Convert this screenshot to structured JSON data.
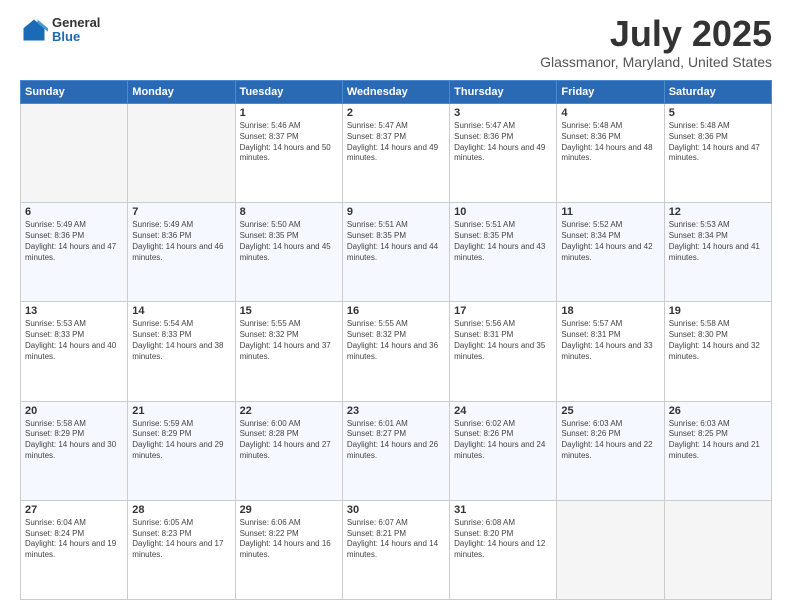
{
  "header": {
    "logo": {
      "line1": "General",
      "line2": "Blue"
    },
    "title": "July 2025",
    "subtitle": "Glassmanor, Maryland, United States"
  },
  "calendar": {
    "days_of_week": [
      "Sunday",
      "Monday",
      "Tuesday",
      "Wednesday",
      "Thursday",
      "Friday",
      "Saturday"
    ],
    "weeks": [
      [
        {
          "day": "",
          "sunrise": "",
          "sunset": "",
          "daylight": "",
          "empty": true
        },
        {
          "day": "",
          "sunrise": "",
          "sunset": "",
          "daylight": "",
          "empty": true
        },
        {
          "day": "1",
          "sunrise": "Sunrise: 5:46 AM",
          "sunset": "Sunset: 8:37 PM",
          "daylight": "Daylight: 14 hours and 50 minutes.",
          "empty": false
        },
        {
          "day": "2",
          "sunrise": "Sunrise: 5:47 AM",
          "sunset": "Sunset: 8:37 PM",
          "daylight": "Daylight: 14 hours and 49 minutes.",
          "empty": false
        },
        {
          "day": "3",
          "sunrise": "Sunrise: 5:47 AM",
          "sunset": "Sunset: 8:36 PM",
          "daylight": "Daylight: 14 hours and 49 minutes.",
          "empty": false
        },
        {
          "day": "4",
          "sunrise": "Sunrise: 5:48 AM",
          "sunset": "Sunset: 8:36 PM",
          "daylight": "Daylight: 14 hours and 48 minutes.",
          "empty": false
        },
        {
          "day": "5",
          "sunrise": "Sunrise: 5:48 AM",
          "sunset": "Sunset: 8:36 PM",
          "daylight": "Daylight: 14 hours and 47 minutes.",
          "empty": false
        }
      ],
      [
        {
          "day": "6",
          "sunrise": "Sunrise: 5:49 AM",
          "sunset": "Sunset: 8:36 PM",
          "daylight": "Daylight: 14 hours and 47 minutes.",
          "empty": false
        },
        {
          "day": "7",
          "sunrise": "Sunrise: 5:49 AM",
          "sunset": "Sunset: 8:36 PM",
          "daylight": "Daylight: 14 hours and 46 minutes.",
          "empty": false
        },
        {
          "day": "8",
          "sunrise": "Sunrise: 5:50 AM",
          "sunset": "Sunset: 8:35 PM",
          "daylight": "Daylight: 14 hours and 45 minutes.",
          "empty": false
        },
        {
          "day": "9",
          "sunrise": "Sunrise: 5:51 AM",
          "sunset": "Sunset: 8:35 PM",
          "daylight": "Daylight: 14 hours and 44 minutes.",
          "empty": false
        },
        {
          "day": "10",
          "sunrise": "Sunrise: 5:51 AM",
          "sunset": "Sunset: 8:35 PM",
          "daylight": "Daylight: 14 hours and 43 minutes.",
          "empty": false
        },
        {
          "day": "11",
          "sunrise": "Sunrise: 5:52 AM",
          "sunset": "Sunset: 8:34 PM",
          "daylight": "Daylight: 14 hours and 42 minutes.",
          "empty": false
        },
        {
          "day": "12",
          "sunrise": "Sunrise: 5:53 AM",
          "sunset": "Sunset: 8:34 PM",
          "daylight": "Daylight: 14 hours and 41 minutes.",
          "empty": false
        }
      ],
      [
        {
          "day": "13",
          "sunrise": "Sunrise: 5:53 AM",
          "sunset": "Sunset: 8:33 PM",
          "daylight": "Daylight: 14 hours and 40 minutes.",
          "empty": false
        },
        {
          "day": "14",
          "sunrise": "Sunrise: 5:54 AM",
          "sunset": "Sunset: 8:33 PM",
          "daylight": "Daylight: 14 hours and 38 minutes.",
          "empty": false
        },
        {
          "day": "15",
          "sunrise": "Sunrise: 5:55 AM",
          "sunset": "Sunset: 8:32 PM",
          "daylight": "Daylight: 14 hours and 37 minutes.",
          "empty": false
        },
        {
          "day": "16",
          "sunrise": "Sunrise: 5:55 AM",
          "sunset": "Sunset: 8:32 PM",
          "daylight": "Daylight: 14 hours and 36 minutes.",
          "empty": false
        },
        {
          "day": "17",
          "sunrise": "Sunrise: 5:56 AM",
          "sunset": "Sunset: 8:31 PM",
          "daylight": "Daylight: 14 hours and 35 minutes.",
          "empty": false
        },
        {
          "day": "18",
          "sunrise": "Sunrise: 5:57 AM",
          "sunset": "Sunset: 8:31 PM",
          "daylight": "Daylight: 14 hours and 33 minutes.",
          "empty": false
        },
        {
          "day": "19",
          "sunrise": "Sunrise: 5:58 AM",
          "sunset": "Sunset: 8:30 PM",
          "daylight": "Daylight: 14 hours and 32 minutes.",
          "empty": false
        }
      ],
      [
        {
          "day": "20",
          "sunrise": "Sunrise: 5:58 AM",
          "sunset": "Sunset: 8:29 PM",
          "daylight": "Daylight: 14 hours and 30 minutes.",
          "empty": false
        },
        {
          "day": "21",
          "sunrise": "Sunrise: 5:59 AM",
          "sunset": "Sunset: 8:29 PM",
          "daylight": "Daylight: 14 hours and 29 minutes.",
          "empty": false
        },
        {
          "day": "22",
          "sunrise": "Sunrise: 6:00 AM",
          "sunset": "Sunset: 8:28 PM",
          "daylight": "Daylight: 14 hours and 27 minutes.",
          "empty": false
        },
        {
          "day": "23",
          "sunrise": "Sunrise: 6:01 AM",
          "sunset": "Sunset: 8:27 PM",
          "daylight": "Daylight: 14 hours and 26 minutes.",
          "empty": false
        },
        {
          "day": "24",
          "sunrise": "Sunrise: 6:02 AM",
          "sunset": "Sunset: 8:26 PM",
          "daylight": "Daylight: 14 hours and 24 minutes.",
          "empty": false
        },
        {
          "day": "25",
          "sunrise": "Sunrise: 6:03 AM",
          "sunset": "Sunset: 8:26 PM",
          "daylight": "Daylight: 14 hours and 22 minutes.",
          "empty": false
        },
        {
          "day": "26",
          "sunrise": "Sunrise: 6:03 AM",
          "sunset": "Sunset: 8:25 PM",
          "daylight": "Daylight: 14 hours and 21 minutes.",
          "empty": false
        }
      ],
      [
        {
          "day": "27",
          "sunrise": "Sunrise: 6:04 AM",
          "sunset": "Sunset: 8:24 PM",
          "daylight": "Daylight: 14 hours and 19 minutes.",
          "empty": false
        },
        {
          "day": "28",
          "sunrise": "Sunrise: 6:05 AM",
          "sunset": "Sunset: 8:23 PM",
          "daylight": "Daylight: 14 hours and 17 minutes.",
          "empty": false
        },
        {
          "day": "29",
          "sunrise": "Sunrise: 6:06 AM",
          "sunset": "Sunset: 8:22 PM",
          "daylight": "Daylight: 14 hours and 16 minutes.",
          "empty": false
        },
        {
          "day": "30",
          "sunrise": "Sunrise: 6:07 AM",
          "sunset": "Sunset: 8:21 PM",
          "daylight": "Daylight: 14 hours and 14 minutes.",
          "empty": false
        },
        {
          "day": "31",
          "sunrise": "Sunrise: 6:08 AM",
          "sunset": "Sunset: 8:20 PM",
          "daylight": "Daylight: 14 hours and 12 minutes.",
          "empty": false
        },
        {
          "day": "",
          "sunrise": "",
          "sunset": "",
          "daylight": "",
          "empty": true
        },
        {
          "day": "",
          "sunrise": "",
          "sunset": "",
          "daylight": "",
          "empty": true
        }
      ]
    ]
  }
}
